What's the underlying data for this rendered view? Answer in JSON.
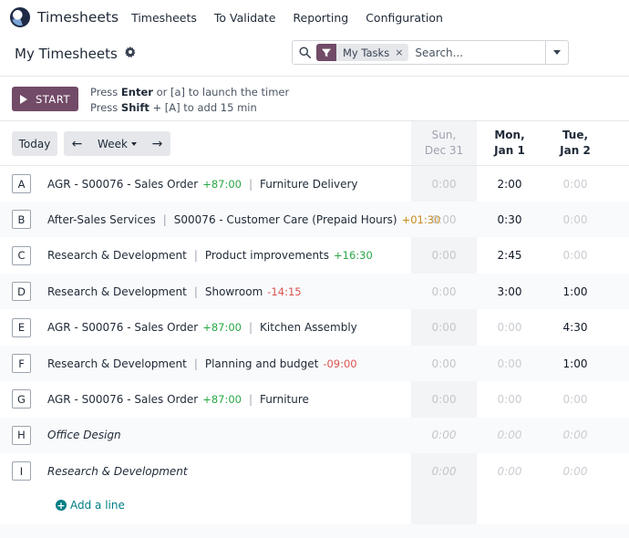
{
  "navbar": {
    "brand": "Timesheets",
    "items": [
      "Timesheets",
      "To Validate",
      "Reporting",
      "Configuration"
    ]
  },
  "control": {
    "title": "My Timesheets",
    "facet": "My Tasks",
    "facet_remove": "×",
    "search_placeholder": "Search..."
  },
  "timer": {
    "start_label": "START",
    "hint1": {
      "pre": "Press ",
      "key": "Enter",
      "post": " or [a] to launch the timer"
    },
    "hint2": {
      "pre": "Press ",
      "key": "Shift",
      "post": " + [A] to add 15 min"
    }
  },
  "grid": {
    "today_label": "Today",
    "range_label": "Week",
    "prev_arrow": "←",
    "next_arrow": "→",
    "days": [
      {
        "dow": "Sun,",
        "date": "Dec 31",
        "weekend": true
      },
      {
        "dow": "Mon,",
        "date": "Jan 1",
        "weekend": false
      },
      {
        "dow": "Tue,",
        "date": "Jan 2",
        "weekend": false
      }
    ],
    "rows": [
      {
        "letter": "A",
        "project": "AGR - S00076 - Sales Order",
        "project_delta": "+87:00",
        "project_delta_type": "pos",
        "task": "Furniture Delivery",
        "task_delta": "",
        "task_delta_type": "",
        "italic": false,
        "values": [
          "0:00",
          "2:00",
          "0:00"
        ]
      },
      {
        "letter": "B",
        "project": "After-Sales Services",
        "project_delta": "",
        "project_delta_type": "",
        "task": "S00076 - Customer Care (Prepaid Hours)",
        "task_delta": "+01:30",
        "task_delta_type": "warn",
        "italic": false,
        "values": [
          "0:00",
          "0:30",
          "0:00"
        ]
      },
      {
        "letter": "C",
        "project": "Research & Development",
        "project_delta": "",
        "project_delta_type": "",
        "task": "Product improvements",
        "task_delta": "+16:30",
        "task_delta_type": "pos",
        "italic": false,
        "values": [
          "0:00",
          "2:45",
          "0:00"
        ]
      },
      {
        "letter": "D",
        "project": "Research & Development",
        "project_delta": "",
        "project_delta_type": "",
        "task": "Showroom",
        "task_delta": "-14:15",
        "task_delta_type": "neg",
        "italic": false,
        "values": [
          "0:00",
          "3:00",
          "1:00"
        ]
      },
      {
        "letter": "E",
        "project": "AGR - S00076 - Sales Order",
        "project_delta": "+87:00",
        "project_delta_type": "pos",
        "task": "Kitchen Assembly",
        "task_delta": "",
        "task_delta_type": "",
        "italic": false,
        "values": [
          "0:00",
          "0:00",
          "4:30"
        ]
      },
      {
        "letter": "F",
        "project": "Research & Development",
        "project_delta": "",
        "project_delta_type": "",
        "task": "Planning and budget",
        "task_delta": "-09:00",
        "task_delta_type": "neg",
        "italic": false,
        "values": [
          "0:00",
          "0:00",
          "1:00"
        ]
      },
      {
        "letter": "G",
        "project": "AGR - S00076 - Sales Order",
        "project_delta": "+87:00",
        "project_delta_type": "pos",
        "task": "Furniture",
        "task_delta": "",
        "task_delta_type": "",
        "italic": false,
        "values": [
          "0:00",
          "0:00",
          "0:00"
        ]
      },
      {
        "letter": "H",
        "project": "Office Design",
        "project_delta": "",
        "project_delta_type": "",
        "task": "",
        "task_delta": "",
        "task_delta_type": "",
        "italic": true,
        "values": [
          "0:00",
          "0:00",
          "0:00"
        ]
      },
      {
        "letter": "I",
        "project": "Research & Development",
        "project_delta": "",
        "project_delta_type": "",
        "task": "",
        "task_delta": "",
        "task_delta_type": "",
        "italic": true,
        "values": [
          "0:00",
          "0:00",
          "0:00"
        ]
      }
    ],
    "add_line_label": "Add a line"
  },
  "colors": {
    "accent": "#714b67",
    "link": "#017e84",
    "positive": "#28a745",
    "negative": "#d9534f",
    "warning": "#c58a1b"
  }
}
